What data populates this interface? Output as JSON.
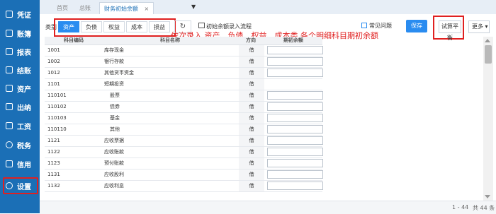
{
  "sidebar": {
    "items": [
      {
        "label": "凭证",
        "icon": "voucher-icon"
      },
      {
        "label": "账簿",
        "icon": "ledger-icon"
      },
      {
        "label": "报表",
        "icon": "report-icon"
      },
      {
        "label": "结账",
        "icon": "closing-icon"
      },
      {
        "label": "资产",
        "icon": "asset-icon"
      },
      {
        "label": "出纳",
        "icon": "cashier-icon"
      },
      {
        "label": "工资",
        "icon": "payroll-icon"
      },
      {
        "label": "税务",
        "icon": "tax-icon"
      },
      {
        "label": "信用",
        "icon": "credit-icon"
      },
      {
        "label": "设置",
        "icon": "gear-icon"
      }
    ]
  },
  "tabs": [
    {
      "label": "首页"
    },
    {
      "label": "总账"
    },
    {
      "label": "财务初始余额",
      "close": "×"
    }
  ],
  "tab_dropdown": "▼",
  "toolbar": {
    "category_label": "类别",
    "categories": [
      "资产",
      "负债",
      "权益",
      "成本",
      "损益"
    ],
    "active_category": "资产",
    "refresh_icon": "↻",
    "flow_link": "初始余额录入流程",
    "annotation": "依次录入 资产、负债、权益、成本类 各个明细科目期初余额",
    "help_link": "常见问题",
    "save_label": "保存",
    "trial_balance_label": "试算平衡",
    "more_label": "更多 ▾"
  },
  "table": {
    "columns": [
      "科目编码",
      "科目名称",
      "方向",
      "期初余额"
    ],
    "rows": [
      {
        "code": "1001",
        "name": "库存现金",
        "dir": "借",
        "indent": false,
        "editable": true
      },
      {
        "code": "1002",
        "name": "银行存款",
        "dir": "借",
        "indent": false,
        "editable": true
      },
      {
        "code": "1012",
        "name": "其他货币资金",
        "dir": "借",
        "indent": false,
        "editable": true
      },
      {
        "code": "1101",
        "name": "短期投资",
        "dir": "借",
        "indent": false,
        "editable": false
      },
      {
        "code": "110101",
        "name": "股票",
        "dir": "借",
        "indent": true,
        "editable": true
      },
      {
        "code": "110102",
        "name": "债券",
        "dir": "借",
        "indent": true,
        "editable": true
      },
      {
        "code": "110103",
        "name": "基金",
        "dir": "借",
        "indent": true,
        "editable": true
      },
      {
        "code": "110110",
        "name": "其他",
        "dir": "借",
        "indent": true,
        "editable": true
      },
      {
        "code": "1121",
        "name": "应收票据",
        "dir": "借",
        "indent": false,
        "editable": true
      },
      {
        "code": "1122",
        "name": "应收账款",
        "dir": "借",
        "indent": false,
        "editable": true
      },
      {
        "code": "1123",
        "name": "预付账款",
        "dir": "借",
        "indent": false,
        "editable": true
      },
      {
        "code": "1131",
        "name": "应收股利",
        "dir": "借",
        "indent": false,
        "editable": true
      },
      {
        "code": "1132",
        "name": "应收利息",
        "dir": "借",
        "indent": false,
        "editable": true
      }
    ]
  },
  "footer": {
    "range": "1 - 44",
    "total": "共 44 条"
  }
}
